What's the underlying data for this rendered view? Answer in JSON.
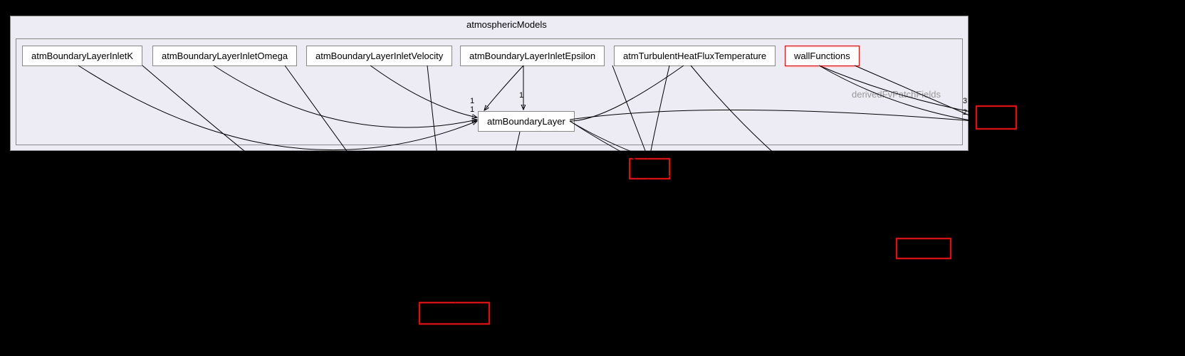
{
  "outer": {
    "title": "atmosphericModels"
  },
  "inner": {
    "label": "derivedFvPatchFields"
  },
  "nodes": {
    "n1": "atmBoundaryLayerInletK",
    "n2": "atmBoundaryLayerInletOmega",
    "n3": "atmBoundaryLayerInletVelocity",
    "n4": "atmBoundaryLayerInletEpsilon",
    "n5": "atmTurbulentHeatFluxTemperature",
    "n6": "wallFunctions",
    "n7": "atmBoundaryLayer"
  },
  "edge_labels": {
    "e1": "1",
    "e2": "1",
    "e3": "1",
    "e4": "3",
    "e5": "2"
  }
}
